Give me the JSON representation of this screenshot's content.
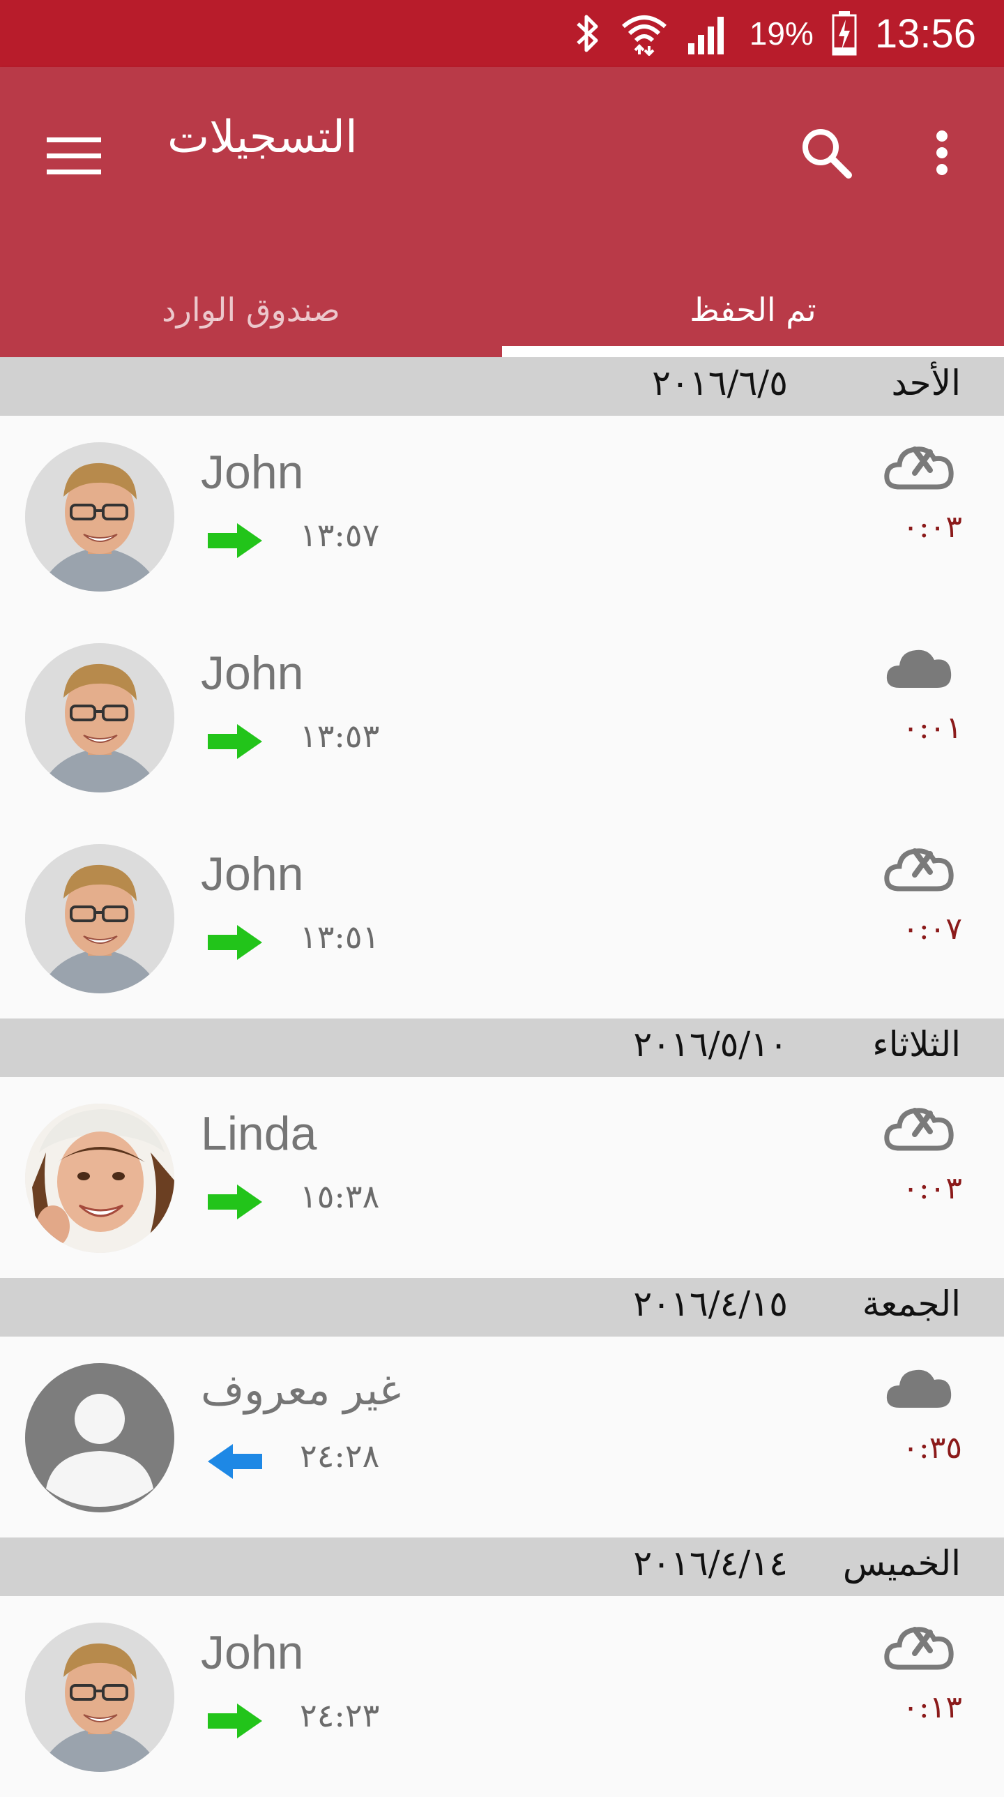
{
  "status_bar": {
    "battery": "19%",
    "time": "13:56",
    "icons": [
      "bluetooth-icon",
      "wifi-icon",
      "signal-icon",
      "battery-charging-icon"
    ]
  },
  "app_bar": {
    "title": "التسجيلات",
    "tabs": [
      {
        "label": "صندوق الوارد",
        "selected": false
      },
      {
        "label": "تم الحفظ",
        "selected": true
      }
    ],
    "colors": {
      "status": "#b81c2b",
      "bar": "#b93a48"
    }
  },
  "sections": [
    {
      "day": "الأحد",
      "date": "٢٠١٦/٦/٥",
      "calls": [
        {
          "name": "John",
          "time": "١٣:٥٧",
          "duration": "٠:٠٣",
          "direction": "outgoing",
          "cloud": "not-synced",
          "avatar": "man"
        },
        {
          "name": "John",
          "time": "١٣:٥٣",
          "duration": "٠:٠١",
          "direction": "outgoing",
          "cloud": "synced",
          "avatar": "man"
        },
        {
          "name": "John",
          "time": "١٣:٥١",
          "duration": "٠:٠٧",
          "direction": "outgoing",
          "cloud": "not-synced",
          "avatar": "man"
        }
      ]
    },
    {
      "day": "الثلاثاء",
      "date": "٢٠١٦/٥/١٠",
      "calls": [
        {
          "name": "Linda",
          "time": "١٥:٣٨",
          "duration": "٠:٠٣",
          "direction": "outgoing",
          "cloud": "not-synced",
          "avatar": "woman"
        }
      ]
    },
    {
      "day": "الجمعة",
      "date": "٢٠١٦/٤/١٥",
      "calls": [
        {
          "name": "غير معروف",
          "time": "٢٤:٢٨",
          "duration": "٠:٣٥",
          "direction": "incoming",
          "cloud": "synced",
          "avatar": "placeholder"
        }
      ]
    },
    {
      "day": "الخميس",
      "date": "٢٠١٦/٤/١٤",
      "calls": [
        {
          "name": "John",
          "time": "٢٤:٢٣",
          "duration": "٠:١٣",
          "direction": "outgoing",
          "cloud": "not-synced",
          "avatar": "man"
        }
      ]
    }
  ]
}
